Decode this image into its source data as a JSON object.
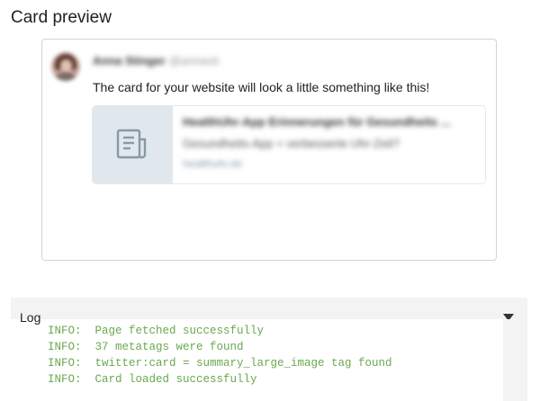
{
  "section_title": "Card preview",
  "tweet": {
    "author_name": "Anna Stinger",
    "author_handle": "@annasti",
    "text": "The card for your website will look a little something like this!"
  },
  "card": {
    "thumbnail_icon": "document-icon",
    "title": "HealthUhr-App Erinnerungen für Gesundheits ...",
    "description": "Gesundheits-App + verbesserte Uhr-Zeit?",
    "domain": "healthuhr.de"
  },
  "log": {
    "label": "Log",
    "lines": [
      "INFO:  Page fetched successfully",
      "INFO:  37 metatags were found",
      "INFO:  twitter:card = summary_large_image tag found",
      "INFO:  Card loaded successfully"
    ]
  },
  "colors": {
    "log_text": "#6aa84f",
    "thumb_bg": "#e1e8ed",
    "panel_border": "#d4d4d4"
  }
}
